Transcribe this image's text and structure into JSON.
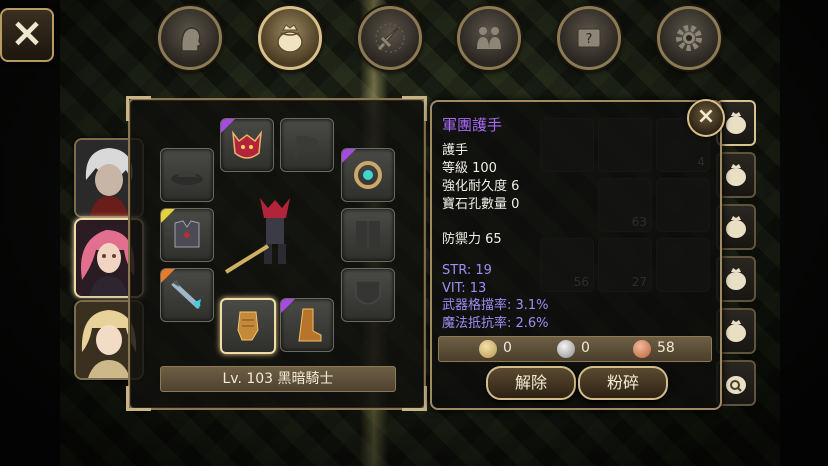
{
  "top": {
    "close_label": "×"
  },
  "nav_tabs": [
    {
      "icon": "character-head-icon"
    },
    {
      "icon": "bag-icon",
      "active": true
    },
    {
      "icon": "sword-icon"
    },
    {
      "icon": "party-icon"
    },
    {
      "icon": "quest-scroll-icon"
    },
    {
      "icon": "gear-icon"
    }
  ],
  "portraits": [
    {
      "name": "white-hair-character"
    },
    {
      "name": "pink-hair-character",
      "selected": true
    },
    {
      "name": "blonde-character"
    }
  ],
  "equipment": {
    "level_label": "Lv. 103 黑暗騎士",
    "slots": [
      "hat",
      "helmet",
      "cape",
      "earring",
      "armor",
      "chest",
      "weapon",
      "gloves",
      "boots",
      "shield"
    ]
  },
  "tooltip": {
    "title": "軍團護手",
    "title_color": "#a66af2",
    "type": "護手",
    "level_line": "等級 100",
    "enhance_line": "強化耐久度 6",
    "socket_line": "寶石孔數量 0",
    "defense_line": "防禦力 65",
    "stats": [
      "STR: 19",
      "VIT: 13",
      "武器格擋率: 3.1%",
      "魔法抵抗率: 2.6%"
    ],
    "stat_color": "#9d8ff5",
    "close_label": "×"
  },
  "currency": [
    {
      "icon": "gold-coin-icon",
      "value": "0"
    },
    {
      "icon": "silver-coin-icon",
      "value": "0"
    },
    {
      "icon": "copper-coin-icon",
      "value": "58"
    }
  ],
  "buttons": {
    "unequip": "解除",
    "shatter": "粉碎"
  },
  "inventory_counts": {
    "c1": "4",
    "c2": "63",
    "c3": "56",
    "c4": "27"
  }
}
